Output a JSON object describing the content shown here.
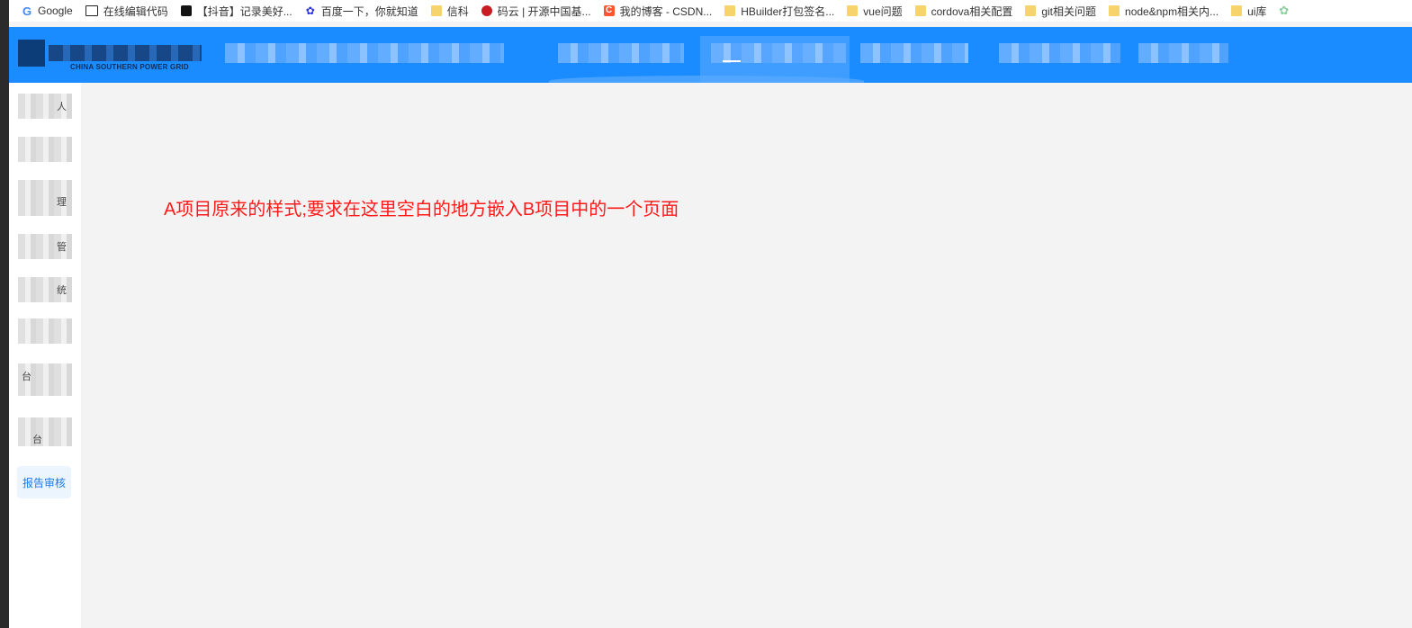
{
  "bookmarks": [
    {
      "label": "Google",
      "icon": "google-icon"
    },
    {
      "label": "在线编辑代码",
      "icon": "square-icon"
    },
    {
      "label": "【抖音】记录美好...",
      "icon": "tiktok-icon"
    },
    {
      "label": "百度一下，你就知道",
      "icon": "baidu-paw-icon"
    },
    {
      "label": "信科",
      "icon": "folder-icon"
    },
    {
      "label": "码云 | 开源中国基...",
      "icon": "gitee-icon"
    },
    {
      "label": "我的博客 - CSDN...",
      "icon": "csdn-icon"
    },
    {
      "label": "HBuilder打包签名...",
      "icon": "folder-icon"
    },
    {
      "label": "vue问题",
      "icon": "folder-icon"
    },
    {
      "label": "cordova相关配置",
      "icon": "folder-icon"
    },
    {
      "label": "git相关问题",
      "icon": "folder-icon"
    },
    {
      "label": "node&npm相关内...",
      "icon": "folder-icon"
    },
    {
      "label": "ui库",
      "icon": "folder-icon"
    }
  ],
  "header": {
    "logo_subtitle": "CHINA SOUTHERN POWER GRID",
    "brand_color": "#1a8cff"
  },
  "sidebar": {
    "item_glyphs": [
      "人",
      "",
      "理",
      "管",
      "统",
      "",
      "台",
      "台"
    ],
    "active_item_label": "报告审核",
    "active_color": "#1a7ae8"
  },
  "main": {
    "note": "A项目原来的样式;要求在这里空白的地方嵌入B项目中的一个页面",
    "note_color": "#ff1a1a"
  }
}
